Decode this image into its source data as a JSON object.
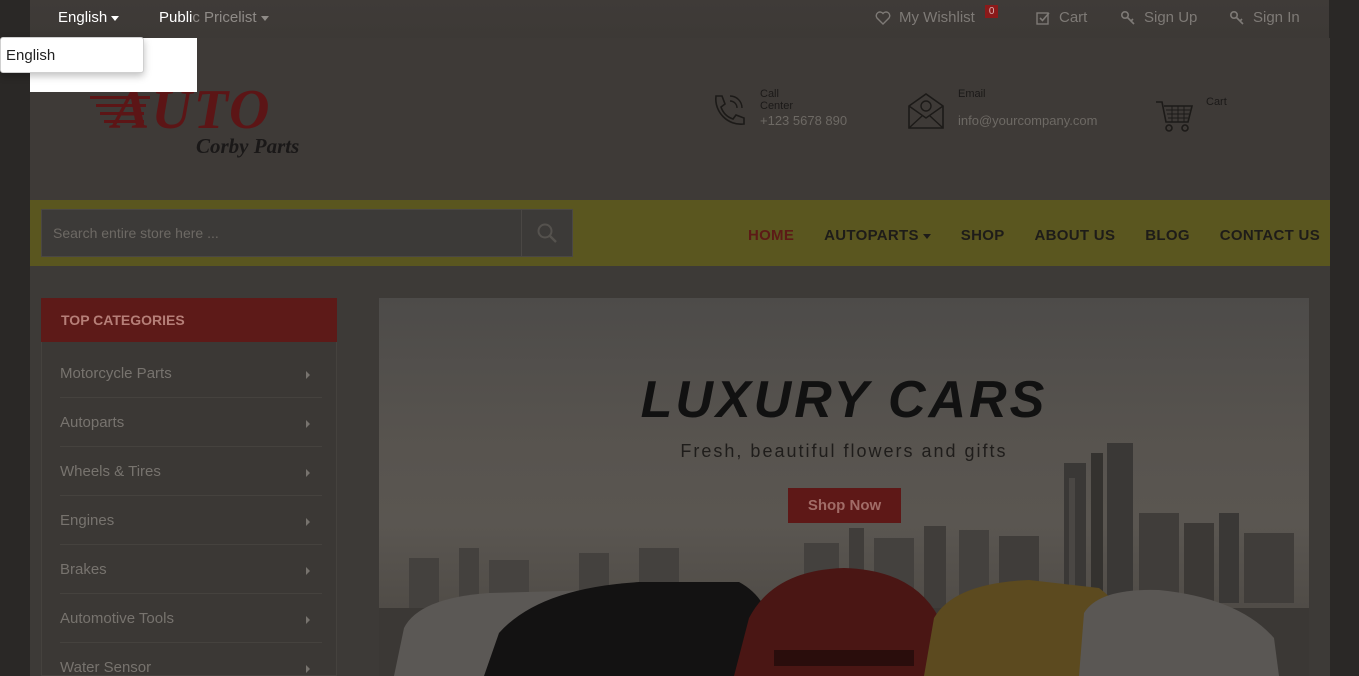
{
  "topbar": {
    "language": "English",
    "pricelist_visible": "Publi",
    "pricelist_rest": "c Pricelist",
    "wishlist_label": "My Wishlist",
    "wishlist_count": "0",
    "cart_label": "Cart",
    "signup_label": "Sign Up",
    "signin_label": "Sign In"
  },
  "language_dropdown": {
    "options": [
      "English"
    ]
  },
  "header": {
    "logo_main": "AUTO",
    "logo_sub": "Corby Parts",
    "call_center_label": "Call Center",
    "call_center_value": "+123 5678 890",
    "email_label": "Email",
    "email_value": "info@yourcompany.com",
    "cart_label": "Cart"
  },
  "search": {
    "placeholder": "Search entire store here ..."
  },
  "menu": {
    "home": "HOME",
    "autoparts": "AUTOPARTS",
    "shop": "SHOP",
    "about": "ABOUT US",
    "blog": "BLOG",
    "contact": "CONTACT US"
  },
  "categories": {
    "title": "TOP CATEGORIES",
    "items": [
      "Motorcycle Parts",
      "Autoparts",
      "Wheels & Tires",
      "Engines",
      "Brakes",
      "Automotive Tools",
      "Water Sensor"
    ]
  },
  "banner": {
    "title": "LUXURY CARS",
    "subtitle": "Fresh, beautiful flowers and gifts",
    "button": "Shop Now"
  },
  "colors": {
    "accent_red": "#c0282a",
    "nav_yellow": "#d8cf2a"
  }
}
